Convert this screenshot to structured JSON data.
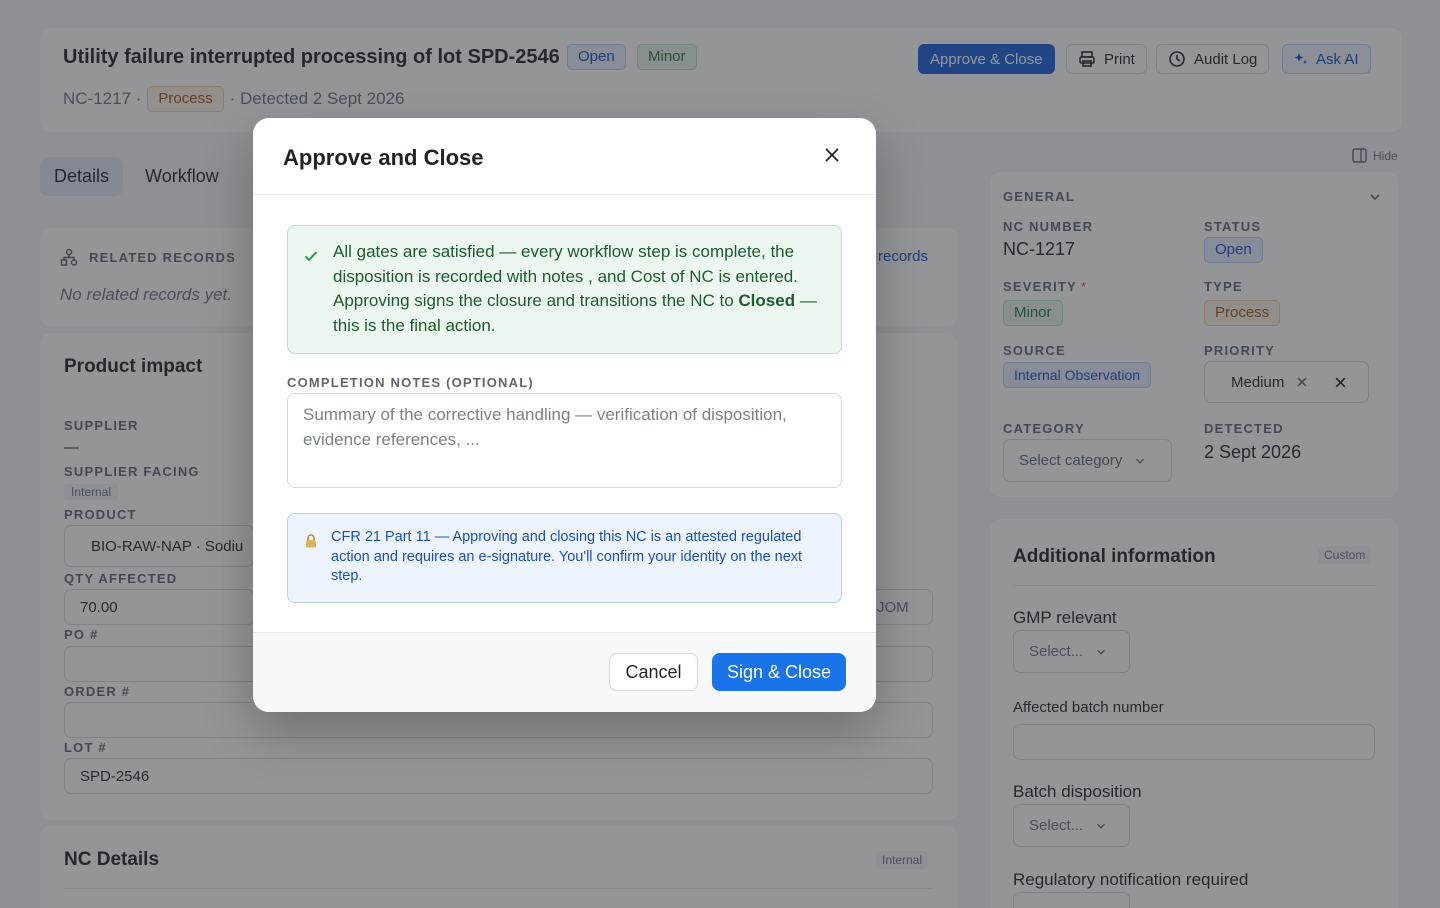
{
  "header": {
    "title": "Utility failure interrupted processing of lot SPD-2546",
    "status_pill": "Open",
    "severity_pill": "Minor",
    "nc_id": "NC-1217 ·",
    "type_pill": "Process",
    "detected": "· Detected 2 Sept 2026",
    "buttons": {
      "approve": "Approve & Close",
      "print": "Print",
      "audit": "Audit Log",
      "ask_ai": "Ask AI"
    }
  },
  "tabs": [
    "Details",
    "Workflow"
  ],
  "related": {
    "label": "RELATED RECORDS",
    "empty": "No related records yet.",
    "link": "records"
  },
  "product_impact": {
    "title": "Product impact",
    "supplier_label": "SUPPLIER",
    "supplier_value": "—",
    "supplier_facing_label": "SUPPLIER FACING",
    "supplier_facing_value": "Internal",
    "product_label": "PRODUCT",
    "product_value": "BIO-RAW-NAP · Sodiu",
    "qty_label": "QTY AFFECTED",
    "qty_value": "70.00",
    "uom_text": "JOM",
    "po_label": "PO #",
    "order_label": "ORDER #",
    "lot_label": "LOT #",
    "lot_value": "SPD-2546"
  },
  "nc_details": {
    "title": "NC Details",
    "tag": "Internal"
  },
  "sidebar": {
    "hide": "Hide",
    "general_title": "GENERAL",
    "nc_number_label": "NC NUMBER",
    "nc_number_value": "NC-1217",
    "status_label": "STATUS",
    "status_value": "Open",
    "severity_label": "SEVERITY",
    "severity_required": "*",
    "severity_value": "Minor",
    "type_label": "TYPE",
    "type_value": "Process",
    "source_label": "SOURCE",
    "source_value": "Internal Observation",
    "priority_label": "PRIORITY",
    "priority_value": "Medium",
    "category_label": "CATEGORY",
    "category_placeholder": "Select category",
    "detected_label": "DETECTED",
    "detected_value": "2 Sept 2026"
  },
  "additional": {
    "title": "Additional information",
    "tag": "Custom",
    "gmp_label": "GMP relevant",
    "gmp_select": "Select...",
    "batch_number_label": "Affected batch number",
    "batch_disp_label": "Batch disposition",
    "batch_disp_select": "Select...",
    "reg_label": "Regulatory notification required"
  },
  "modal": {
    "title": "Approve and Close",
    "success_pre": "All gates are satisfied — every workflow step is complete, the disposition is recorded with notes , and Cost of NC is entered. Approving signs the closure and transitions the NC to",
    "success_bold": "Closed",
    "success_post": "— this is the final action.",
    "notes_label": "COMPLETION NOTES (OPTIONAL)",
    "notes_placeholder": "Summary of the corrective handling — verification of disposition, evidence references, ...",
    "info_text": "CFR 21 Part 11 — Approving and closing this NC is an attested regulated action and requires an e-signature. You'll confirm your identity on the next step.",
    "cancel": "Cancel",
    "sign": "Sign & Close"
  },
  "colors": {
    "primary": "#1a73e8",
    "overlay": "#282c34",
    "success_bg": "#ecf8ef",
    "info_bg": "#eef4fd"
  }
}
